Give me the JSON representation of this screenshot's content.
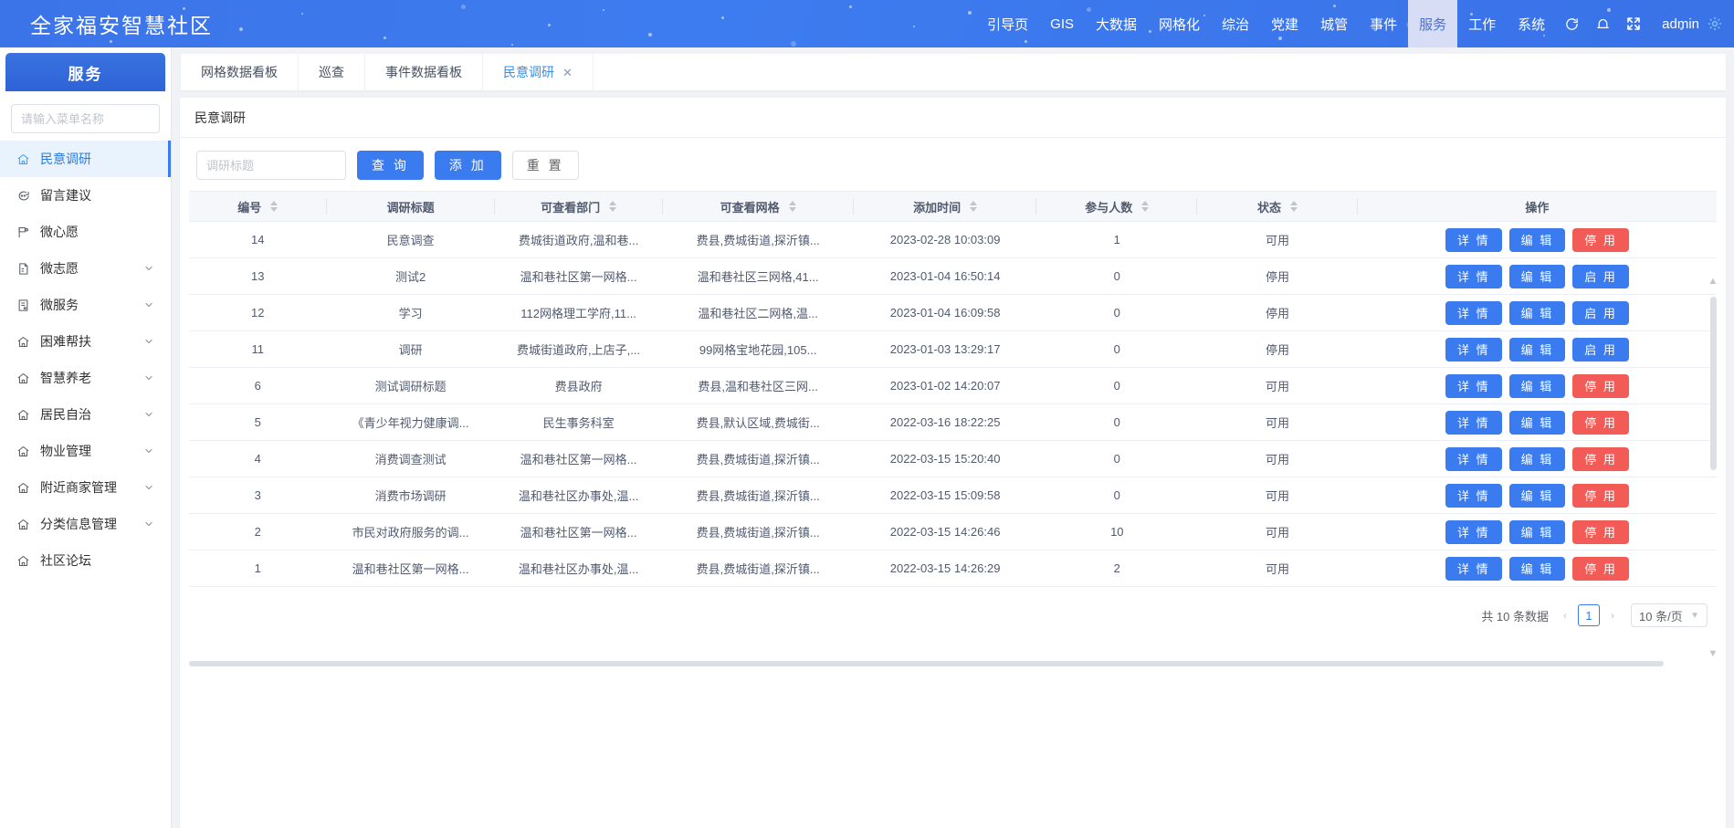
{
  "header": {
    "brand": "全家福安智慧社区",
    "nav": [
      {
        "label": "引导页",
        "active": false
      },
      {
        "label": "GIS",
        "active": false
      },
      {
        "label": "大数据",
        "active": false
      },
      {
        "label": "网格化",
        "active": false
      },
      {
        "label": "综治",
        "active": false
      },
      {
        "label": "党建",
        "active": false
      },
      {
        "label": "城管",
        "active": false
      },
      {
        "label": "事件",
        "active": false
      },
      {
        "label": "服务",
        "active": true
      },
      {
        "label": "工作",
        "active": false
      },
      {
        "label": "系统",
        "active": false
      }
    ],
    "icons": [
      "refresh-icon",
      "bell-icon",
      "fullscreen-icon"
    ],
    "user": "admin",
    "accent": "#3a7bef"
  },
  "sidebar": {
    "title": "服务",
    "search_placeholder": "请输入菜单名称",
    "search_value": "",
    "items": [
      {
        "label": "民意调研",
        "icon": "home-icon",
        "arrow": false,
        "active": true
      },
      {
        "label": "留言建议",
        "icon": "comment-icon",
        "arrow": false,
        "active": false
      },
      {
        "label": "微心愿",
        "icon": "flag-icon",
        "arrow": false,
        "active": false
      },
      {
        "label": "微志愿",
        "icon": "document-icon",
        "arrow": true,
        "active": false
      },
      {
        "label": "微服务",
        "icon": "form-icon",
        "arrow": true,
        "active": false
      },
      {
        "label": "困难帮扶",
        "icon": "home-icon",
        "arrow": true,
        "active": false
      },
      {
        "label": "智慧养老",
        "icon": "home-icon",
        "arrow": true,
        "active": false
      },
      {
        "label": "居民自治",
        "icon": "home-icon",
        "arrow": true,
        "active": false
      },
      {
        "label": "物业管理",
        "icon": "home-icon",
        "arrow": true,
        "active": false
      },
      {
        "label": "附近商家管理",
        "icon": "home-icon",
        "arrow": true,
        "active": false
      },
      {
        "label": "分类信息管理",
        "icon": "home-icon",
        "arrow": true,
        "active": false
      },
      {
        "label": "社区论坛",
        "icon": "home-icon",
        "arrow": false,
        "active": false
      }
    ]
  },
  "tabs": [
    {
      "label": "网格数据看板",
      "active": false,
      "closable": false
    },
    {
      "label": "巡查",
      "active": false,
      "closable": false
    },
    {
      "label": "事件数据看板",
      "active": false,
      "closable": false
    },
    {
      "label": "民意调研",
      "active": true,
      "closable": true,
      "close": "✕"
    }
  ],
  "panel": {
    "title": "民意调研",
    "toolbar": {
      "search_placeholder": "调研标题",
      "search_value": "",
      "query_label": "查 询",
      "add_label": "添 加",
      "reset_label": "重 置"
    },
    "columns": [
      {
        "label": "编号",
        "sortable": true,
        "width": "9%"
      },
      {
        "label": "调研标题",
        "sortable": false,
        "width": "11%"
      },
      {
        "label": "可查看部门",
        "sortable": true,
        "width": "11%"
      },
      {
        "label": "可查看网格",
        "sortable": true,
        "width": "12.5%"
      },
      {
        "label": "添加时间",
        "sortable": true,
        "width": "12%"
      },
      {
        "label": "参与人数",
        "sortable": true,
        "width": "10.5%"
      },
      {
        "label": "状态",
        "sortable": true,
        "width": "10.5%"
      },
      {
        "label": "操作",
        "sortable": false,
        "width": "23.5%"
      }
    ],
    "rows": [
      {
        "id": "14",
        "title": "民意调查",
        "dept": "费城街道政府,温和巷...",
        "grid": "费县,费城街道,探沂镇...",
        "time": "2023-02-28 10:03:09",
        "count": "1",
        "status": "可用",
        "ops": [
          {
            "label": "详 情",
            "kind": "detail"
          },
          {
            "label": "编 辑",
            "kind": "edit"
          },
          {
            "label": "停 用",
            "kind": "disable"
          }
        ]
      },
      {
        "id": "13",
        "title": "测试2",
        "dept": "温和巷社区第一网格...",
        "grid": "温和巷社区三网格,41...",
        "time": "2023-01-04 16:50:14",
        "count": "0",
        "status": "停用",
        "ops": [
          {
            "label": "详 情",
            "kind": "detail"
          },
          {
            "label": "编 辑",
            "kind": "edit"
          },
          {
            "label": "启 用",
            "kind": "enable"
          }
        ]
      },
      {
        "id": "12",
        "title": "学习",
        "dept": "112网格理工学府,11...",
        "grid": "温和巷社区二网格,温...",
        "time": "2023-01-04 16:09:58",
        "count": "0",
        "status": "停用",
        "ops": [
          {
            "label": "详 情",
            "kind": "detail"
          },
          {
            "label": "编 辑",
            "kind": "edit"
          },
          {
            "label": "启 用",
            "kind": "enable"
          }
        ]
      },
      {
        "id": "11",
        "title": "调研",
        "dept": "费城街道政府,上店子,...",
        "grid": "99网格宝地花园,105...",
        "time": "2023-01-03 13:29:17",
        "count": "0",
        "status": "停用",
        "ops": [
          {
            "label": "详 情",
            "kind": "detail"
          },
          {
            "label": "编 辑",
            "kind": "edit"
          },
          {
            "label": "启 用",
            "kind": "enable"
          }
        ]
      },
      {
        "id": "6",
        "title": "测试调研标题",
        "dept": "费县政府",
        "grid": "费县,温和巷社区三网...",
        "time": "2023-01-02 14:20:07",
        "count": "0",
        "status": "可用",
        "ops": [
          {
            "label": "详 情",
            "kind": "detail"
          },
          {
            "label": "编 辑",
            "kind": "edit"
          },
          {
            "label": "停 用",
            "kind": "disable"
          }
        ]
      },
      {
        "id": "5",
        "title": "《青少年视力健康调...",
        "dept": "民生事务科室",
        "grid": "费县,默认区域,费城街...",
        "time": "2022-03-16 18:22:25",
        "count": "0",
        "status": "可用",
        "ops": [
          {
            "label": "详 情",
            "kind": "detail"
          },
          {
            "label": "编 辑",
            "kind": "edit"
          },
          {
            "label": "停 用",
            "kind": "disable"
          }
        ]
      },
      {
        "id": "4",
        "title": "消费调查测试",
        "dept": "温和巷社区第一网格...",
        "grid": "费县,费城街道,探沂镇...",
        "time": "2022-03-15 15:20:40",
        "count": "0",
        "status": "可用",
        "ops": [
          {
            "label": "详 情",
            "kind": "detail"
          },
          {
            "label": "编 辑",
            "kind": "edit"
          },
          {
            "label": "停 用",
            "kind": "disable"
          }
        ]
      },
      {
        "id": "3",
        "title": "消费市场调研",
        "dept": "温和巷社区办事处,温...",
        "grid": "费县,费城街道,探沂镇...",
        "time": "2022-03-15 15:09:58",
        "count": "0",
        "status": "可用",
        "ops": [
          {
            "label": "详 情",
            "kind": "detail"
          },
          {
            "label": "编 辑",
            "kind": "edit"
          },
          {
            "label": "停 用",
            "kind": "disable"
          }
        ]
      },
      {
        "id": "2",
        "title": "市民对政府服务的调...",
        "dept": "温和巷社区第一网格...",
        "grid": "费县,费城街道,探沂镇...",
        "time": "2022-03-15 14:26:46",
        "count": "10",
        "status": "可用",
        "ops": [
          {
            "label": "详 情",
            "kind": "detail"
          },
          {
            "label": "编 辑",
            "kind": "edit"
          },
          {
            "label": "停 用",
            "kind": "disable"
          }
        ]
      },
      {
        "id": "1",
        "title": "温和巷社区第一网格...",
        "dept": "温和巷社区办事处,温...",
        "grid": "费县,费城街道,探沂镇...",
        "time": "2022-03-15 14:26:29",
        "count": "2",
        "status": "可用",
        "ops": [
          {
            "label": "详 情",
            "kind": "detail"
          },
          {
            "label": "编 辑",
            "kind": "edit"
          },
          {
            "label": "停 用",
            "kind": "disable"
          }
        ]
      }
    ],
    "pagination": {
      "total_text": "共 10 条数据",
      "prev": "‹",
      "next": "›",
      "current_page": "1",
      "page_size": "10 条/页"
    }
  }
}
